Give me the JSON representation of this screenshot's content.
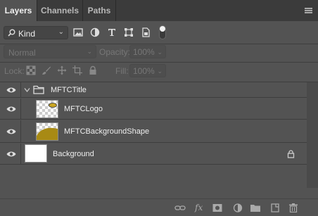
{
  "tabs": [
    {
      "label": "Layers",
      "active": true
    },
    {
      "label": "Channels",
      "active": false
    },
    {
      "label": "Paths",
      "active": false
    }
  ],
  "filter": {
    "kind_label": "Kind",
    "icons": [
      "pixel-layer-filter-icon",
      "adjustment-layer-filter-icon",
      "type-layer-filter-icon",
      "shape-layer-filter-icon",
      "smart-object-filter-icon",
      "filter-toggle-icon"
    ]
  },
  "blend": {
    "mode": "Normal",
    "opacity_label": "Opacity:",
    "opacity_value": "100%",
    "fill_label": "Fill:",
    "fill_value": "100%"
  },
  "lock": {
    "label": "Lock:",
    "icons": [
      "lock-transparent-pixels-icon",
      "lock-image-pixels-icon",
      "lock-position-icon",
      "lock-artboard-icon",
      "lock-all-icon"
    ]
  },
  "layers": [
    {
      "name": "MFTCTitle",
      "type": "group",
      "visible": true,
      "expanded": true
    },
    {
      "name": "MFTCLogo",
      "type": "layer",
      "visible": true,
      "indent": 1
    },
    {
      "name": "MFTCBackgroundShape",
      "type": "layer",
      "visible": true,
      "indent": 1
    },
    {
      "name": "Background",
      "type": "background",
      "visible": true,
      "locked": true
    }
  ],
  "footer_icons": [
    "link-layers-icon",
    "fx-icon",
    "add-mask-icon",
    "adjustment-layer-icon",
    "new-group-icon",
    "new-layer-icon",
    "delete-layer-icon"
  ],
  "colors": {
    "panel_bg": "#535353",
    "tabbar_bg": "#3b3b3b",
    "shape_fill": "#a88a14"
  }
}
